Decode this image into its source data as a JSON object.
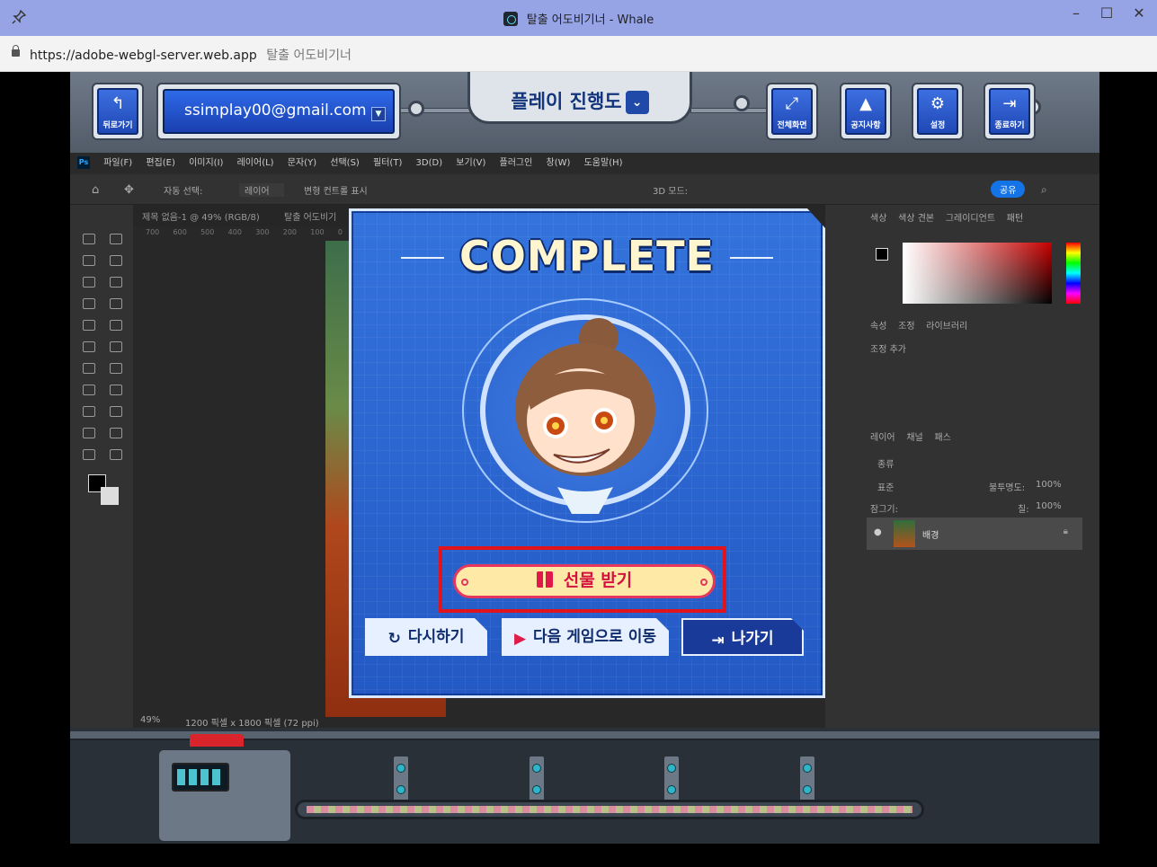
{
  "browser": {
    "window_title": "탈출 어도비기너 - Whale",
    "url": "https://adobe-webgl-server.web.app",
    "page_title": "탈출 어도비기너"
  },
  "hud": {
    "back_label": "뒤로가기",
    "email": "ssimplay00@gmail.com",
    "progress_label": "플레이 진행도",
    "fullscreen_label": "전체화면",
    "notice_label": "공지사항",
    "settings_label": "설정",
    "quit_label": "종료하기"
  },
  "photoshop": {
    "menu": [
      "파일(F)",
      "편집(E)",
      "이미지(I)",
      "레이어(L)",
      "문자(Y)",
      "선택(S)",
      "필터(T)",
      "3D(D)",
      "보기(V)",
      "플러그인",
      "창(W)",
      "도움말(H)"
    ],
    "options": {
      "auto_select": "자동 선택:",
      "layer_select": "레이어",
      "show_transform": "변형 컨트롤 표시",
      "mode_3d": "3D 모드:",
      "share": "공유"
    },
    "tabs": [
      "제목 없음-1 @ 49% (RGB/8)",
      "탈출 어도비기"
    ],
    "ruler": [
      "700",
      "600",
      "500",
      "400",
      "300",
      "200",
      "100",
      "0"
    ],
    "status_zoom": "49%",
    "status_doc": "1200 픽셀 x 1800 픽셀 (72 ppi)",
    "color_tabs": [
      "색상",
      "색상 견본",
      "그레이디언트",
      "패턴"
    ],
    "adjust_tabs": [
      "속성",
      "조정",
      "라이브러리"
    ],
    "adjust_add": "조정 추가",
    "layer_tabs": [
      "레이어",
      "채널",
      "패스"
    ],
    "layer_search": "종류",
    "layer_blend": "표준",
    "layer_opacity_label": "불투명도:",
    "layer_opacity": "100%",
    "layer_lock_label": "잠그기:",
    "layer_fill_label": "칠:",
    "layer_fill": "100%",
    "layer_name": "배경"
  },
  "dialog": {
    "title": "COMPLETE",
    "gift_button": "선물 받기",
    "retry_button": "다시하기",
    "next_button": "다음 게임으로 이동",
    "exit_button": "나가기"
  },
  "colors": {
    "dialog_bg": "#2d66d2",
    "highlight": "#e0141a",
    "gift_bg": "#ffe9a7",
    "gift_text": "#d31240",
    "exit_bg": "#1a3a9a"
  }
}
